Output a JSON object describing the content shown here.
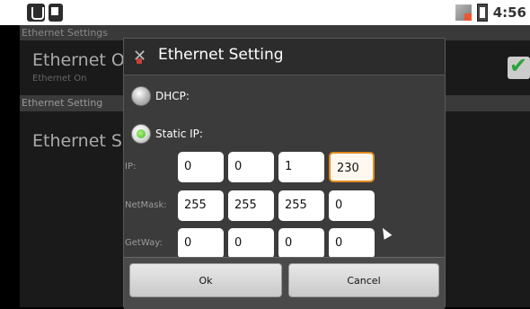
{
  "statusbar": {
    "time": "4:56"
  },
  "background": {
    "header": "Ethernet Settings",
    "pref1_title": "Ethernet On",
    "pref1_summary": "Ethernet On",
    "category": "Ethernet Setting",
    "pref2_title": "Ethernet Set"
  },
  "dialog": {
    "title": "Ethernet Setting",
    "dhcp_label": "DHCP:",
    "static_label": "Static IP:",
    "selected_mode": "Static IP",
    "ip_label": "IP:",
    "ip": [
      "0",
      "0",
      "1",
      "230"
    ],
    "netmask_label": "NetMask:",
    "netmask": [
      "255",
      "255",
      "255",
      "0"
    ],
    "gateway_label": "GetWay:",
    "gateway": [
      "0",
      "0",
      "0",
      "0"
    ],
    "ok_label": "Ok",
    "cancel_label": "Cancel"
  },
  "colors": {
    "focus_border": "#e08b1e",
    "radio_selected": "#3cbf22",
    "check": "#2aa33a"
  }
}
